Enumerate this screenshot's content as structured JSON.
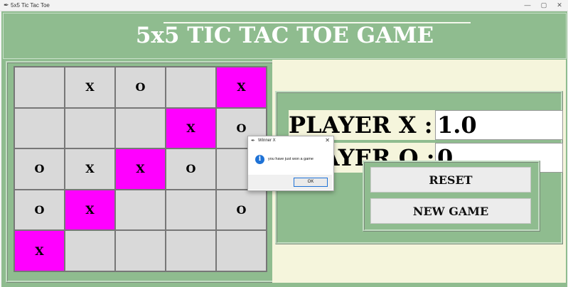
{
  "window": {
    "title": "5x5 Tic Tac Toe",
    "controls": {
      "minimize": "—",
      "maximize": "▢",
      "close": "✕"
    }
  },
  "app": {
    "heading": "5x5 TIC TAC TOE GAME"
  },
  "board": {
    "rows": [
      [
        "",
        "X",
        "O",
        "",
        "X"
      ],
      [
        "",
        "",
        "",
        "X",
        "O"
      ],
      [
        "O",
        "X",
        "X",
        "O",
        ""
      ],
      [
        "O",
        "X",
        "",
        "",
        "O"
      ],
      [
        "X",
        "",
        "",
        "",
        ""
      ]
    ],
    "winning_cells": [
      [
        0,
        4
      ],
      [
        1,
        3
      ],
      [
        2,
        2
      ],
      [
        3,
        1
      ],
      [
        4,
        0
      ]
    ],
    "win_color": "#ff00ff",
    "cell_color": "#d9d9d9"
  },
  "scores": {
    "player_x_label": "PLAYER X :",
    "player_x_value": "1.0",
    "player_o_label": "PLAYER O :",
    "player_o_value": "0"
  },
  "buttons": {
    "reset_label": "RESET",
    "new_game_label": "NEW GAME"
  },
  "dialog": {
    "title": "Winner X",
    "message": "you have just won a game",
    "ok_label": "OK",
    "icon": "info-icon",
    "close": "✕"
  },
  "colors": {
    "accent_green": "#8fbc8f",
    "panel_beige": "#f5f5dc"
  }
}
